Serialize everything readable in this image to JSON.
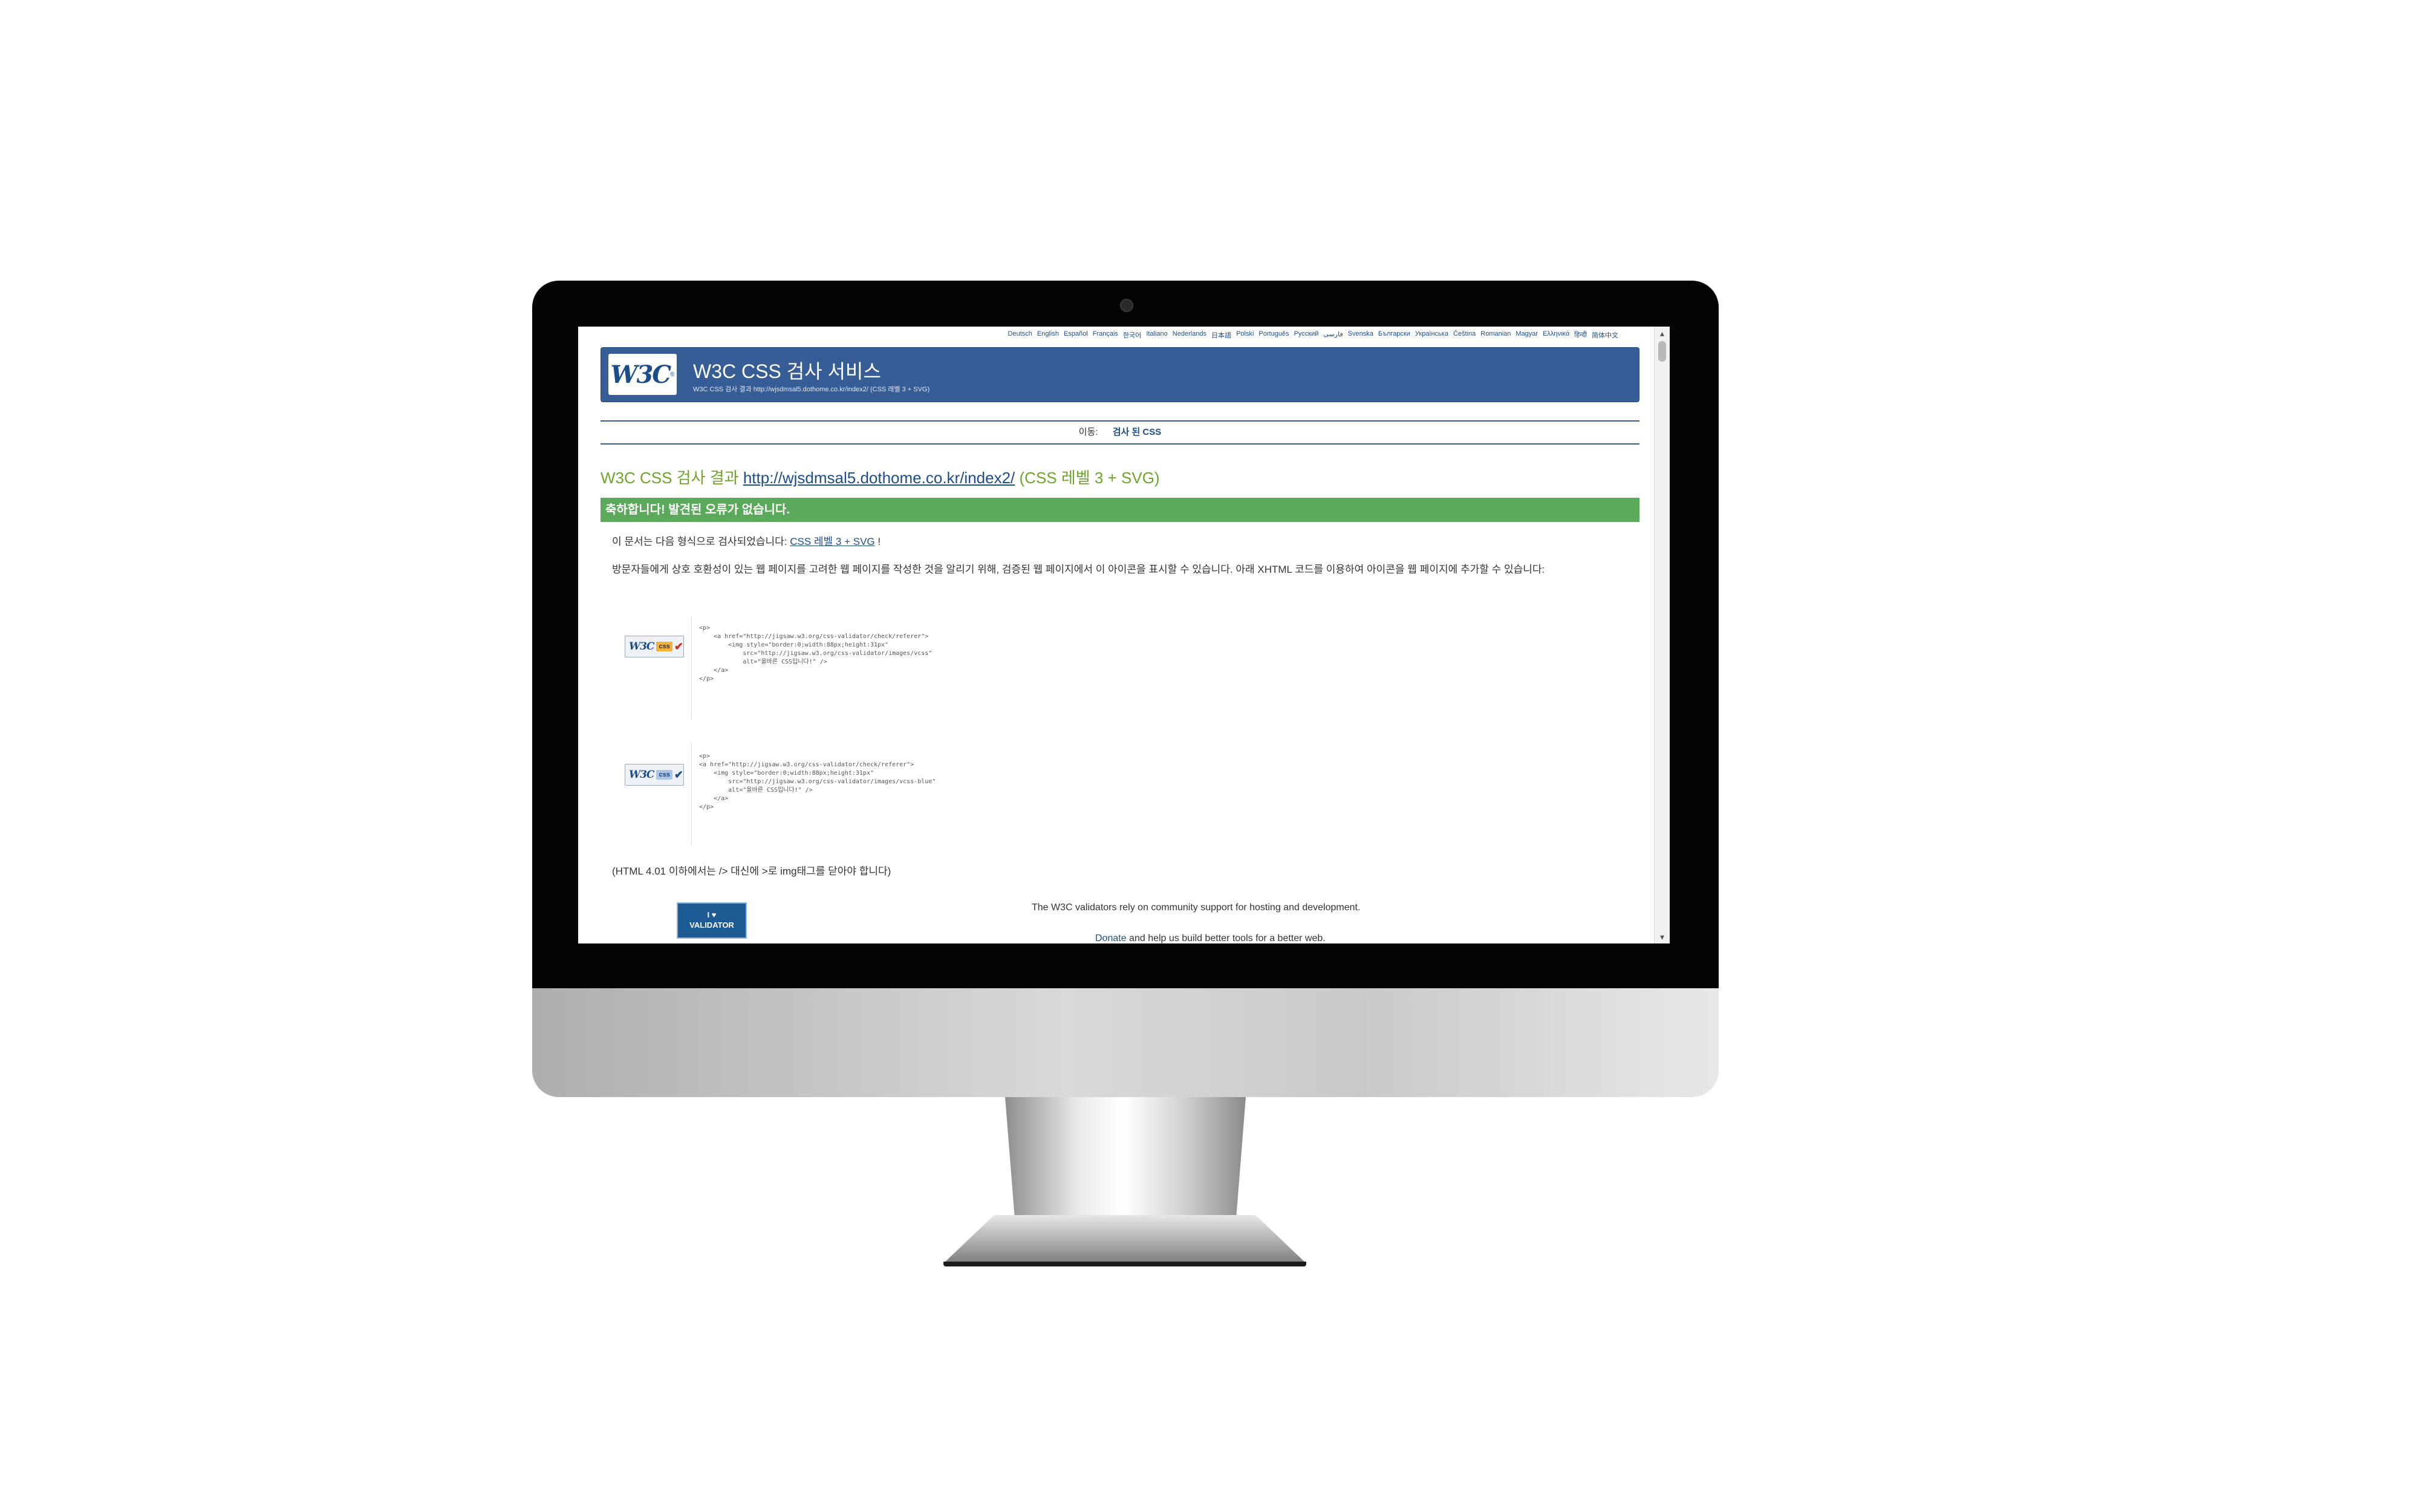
{
  "languages": [
    "Deutsch",
    "English",
    "Español",
    "Français",
    "한국어",
    "Italiano",
    "Nederlands",
    "日本語",
    "Polski",
    "Português",
    "Русский",
    "فارسی",
    "Svenska",
    "Български",
    "Українська",
    "Čeština",
    "Romanian",
    "Magyar",
    "Ελληνικά",
    "हिन्दी",
    "简体中文"
  ],
  "header": {
    "logo": "W3C",
    "title": "W3C CSS 검사 서비스",
    "subtitle": "W3C CSS 검사 결과 http://wjsdmsal5.dothome.co.kr/index2/ (CSS 레벨 3 + SVG)"
  },
  "jump": {
    "label": "이동:",
    "link": "검사 된 CSS"
  },
  "result": {
    "title_prefix": "W3C CSS 검사 결과",
    "url": "http://wjsdmsal5.dothome.co.kr/index2/",
    "title_suffix": "(CSS 레벨 3 + SVG)",
    "congrats": "축하합니다! 발견된 오류가 없습니다.",
    "validated_prefix": "이 문서는 다음 형식으로 검사되었습니다:",
    "validated_profile": "CSS 레벨 3 + SVG",
    "validated_suffix": "!",
    "badge_info": "방문자들에게 상호 호환성이 있는 웹 페이지를 고려한 웹 페이지를 작성한 것을 알리기 위해, 검증된 웹 페이지에서 이 아이콘을 표시할 수 있습니다. 아래 XHTML 코드를 이용하여 아이콘을 웹 페이지에 추가할 수 있습니다:",
    "code_gold": "<p>\n    <a href=\"http://jigsaw.w3.org/css-validator/check/referer\">\n        <img style=\"border:0;width:88px;height:31px\"\n            src=\"http://jigsaw.w3.org/css-validator/images/vcss\"\n            alt=\"올바른 CSS입니다!\" />\n    </a>\n</p>",
    "code_blue": "<p>\n<a href=\"http://jigsaw.w3.org/css-validator/check/referer\">\n    <img style=\"border:0;width:88px;height:31px\"\n        src=\"http://jigsaw.w3.org/css-validator/images/vcss-blue\"\n        alt=\"올바른 CSS입니다!\" />\n    </a>\n</p>",
    "html401_note": "(HTML 4.01 이하에서는 /> 대신에 >로 img태그를 닫아야 합니다)"
  },
  "badges": {
    "w3c": "W3C",
    "css": "css",
    "check": "✔"
  },
  "footer": {
    "validator_badge_line1": "I ♥",
    "validator_badge_line2": "VALIDATOR",
    "support": "The W3C validators rely on community support for hosting and development.",
    "donate_link": "Donate",
    "donate_rest": "and help us build better tools for a better web."
  }
}
